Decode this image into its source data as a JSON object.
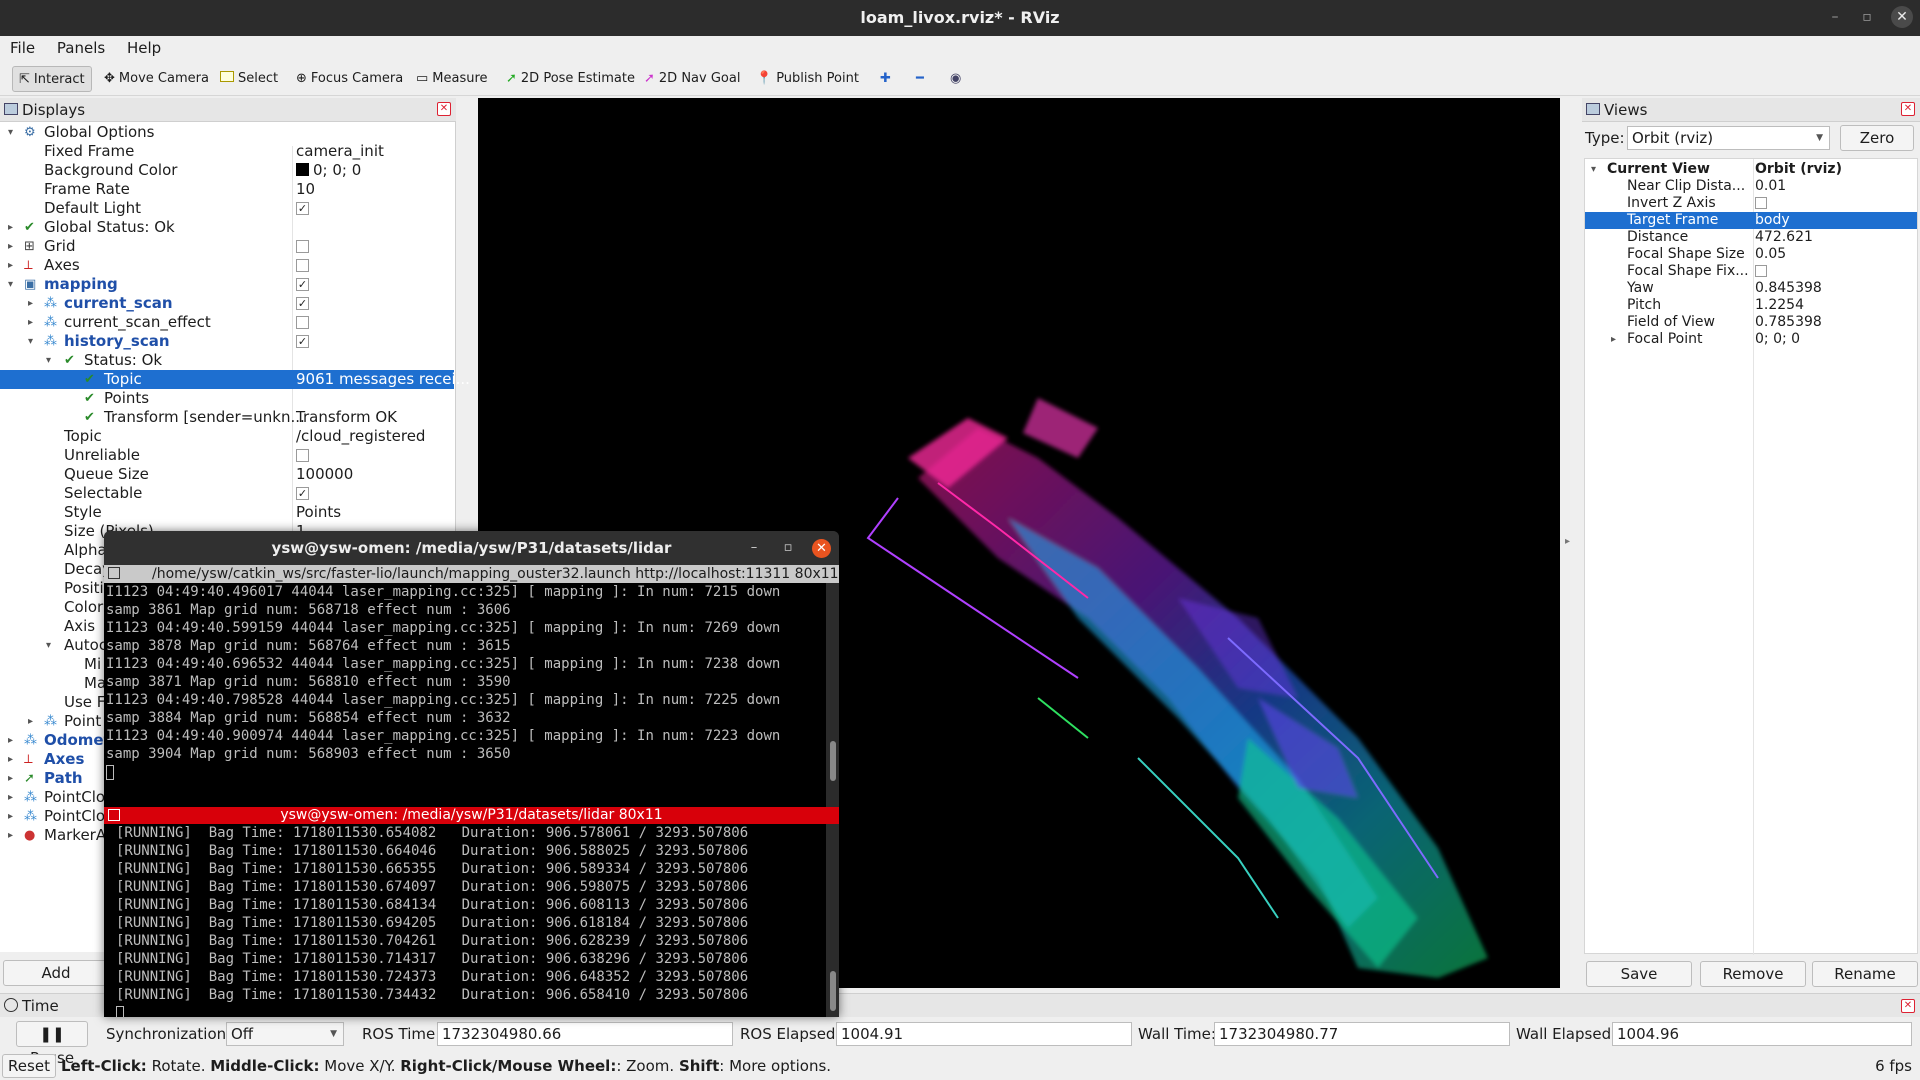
{
  "window": {
    "title": "loam_livox.rviz* - RViz"
  },
  "menu": [
    "File",
    "Panels",
    "Help"
  ],
  "toolbar": {
    "interact": "Interact",
    "move_camera": "Move Camera",
    "select": "Select",
    "focus_camera": "Focus Camera",
    "measure": "Measure",
    "pose_estimate": "2D Pose Estimate",
    "nav_goal": "2D Nav Goal",
    "publish_point": "Publish Point"
  },
  "displays": {
    "title": "Displays",
    "add_label": "Add",
    "rows": [
      {
        "label": "Global Options",
        "value": ""
      },
      {
        "label": "Fixed Frame",
        "value": "camera_init"
      },
      {
        "label": "Background Color",
        "value": "0; 0; 0"
      },
      {
        "label": "Frame Rate",
        "value": "10"
      },
      {
        "label": "Default Light",
        "value": "✓"
      },
      {
        "label": "Global Status: Ok",
        "value": ""
      },
      {
        "label": "Grid",
        "value": ""
      },
      {
        "label": "Axes",
        "value": ""
      },
      {
        "label": "mapping",
        "value": "✓"
      },
      {
        "label": "current_scan",
        "value": "✓"
      },
      {
        "label": "current_scan_effect",
        "value": ""
      },
      {
        "label": "history_scan",
        "value": "✓"
      },
      {
        "label": "Status: Ok",
        "value": ""
      },
      {
        "label": "Topic",
        "value": "9061 messages recei..."
      },
      {
        "label": "Points",
        "value": ""
      },
      {
        "label": "Transform [sender=unkn...",
        "value": "Transform OK"
      },
      {
        "label": "Topic",
        "value": "/cloud_registered"
      },
      {
        "label": "Unreliable",
        "value": ""
      },
      {
        "label": "Queue Size",
        "value": "100000"
      },
      {
        "label": "Selectable",
        "value": "✓"
      },
      {
        "label": "Style",
        "value": "Points"
      },
      {
        "label": "Size (Pixels)",
        "value": "1"
      },
      {
        "label": "Alpha",
        "value": ""
      },
      {
        "label": "Decay",
        "value": ""
      },
      {
        "label": "Positi",
        "value": ""
      },
      {
        "label": "Color",
        "value": ""
      },
      {
        "label": "Axis",
        "value": ""
      },
      {
        "label": "Autoc",
        "value": ""
      },
      {
        "label": "Mi",
        "value": ""
      },
      {
        "label": "Ma",
        "value": ""
      },
      {
        "label": "Use Fi",
        "value": ""
      },
      {
        "label": "Point",
        "value": ""
      },
      {
        "label": "Odomet",
        "value": ""
      },
      {
        "label": "Axes",
        "value": ""
      },
      {
        "label": "Path",
        "value": ""
      },
      {
        "label": "PointClo",
        "value": ""
      },
      {
        "label": "PointClo",
        "value": ""
      },
      {
        "label": "MarkerA",
        "value": ""
      }
    ]
  },
  "views": {
    "title": "Views",
    "type_label": "Type:",
    "type_value": "Orbit (rviz)",
    "zero_label": "Zero",
    "rows": [
      {
        "label": "Current View",
        "value": "Orbit (rviz)"
      },
      {
        "label": "Near Clip Dista...",
        "value": "0.01"
      },
      {
        "label": "Invert Z Axis",
        "value": ""
      },
      {
        "label": "Target Frame",
        "value": "body"
      },
      {
        "label": "Distance",
        "value": "472.621"
      },
      {
        "label": "Focal Shape Size",
        "value": "0.05"
      },
      {
        "label": "Focal Shape Fix...",
        "value": ""
      },
      {
        "label": "Yaw",
        "value": "0.845398"
      },
      {
        "label": "Pitch",
        "value": "1.2254"
      },
      {
        "label": "Field of View",
        "value": "0.785398"
      },
      {
        "label": "Focal Point",
        "value": "0; 0; 0"
      }
    ],
    "save_label": "Save",
    "remove_label": "Remove",
    "rename_label": "Rename"
  },
  "terminal": {
    "title": "ysw@ysw-omen: /media/ysw/P31/datasets/lidar",
    "path_bar": "/home/ysw/catkin_ws/src/faster-lio/launch/mapping_ouster32.launch http://localhost:11311 80x11",
    "pane1_lines": [
      "I1123 04:49:40.496017 44044 laser_mapping.cc:325] [ mapping ]: In num: 7215 down",
      "samp 3861 Map grid num: 568718 effect num : 3606",
      "I1123 04:49:40.599159 44044 laser_mapping.cc:325] [ mapping ]: In num: 7269 down",
      "samp 3878 Map grid num: 568764 effect num : 3615",
      "I1123 04:49:40.696532 44044 laser_mapping.cc:325] [ mapping ]: In num: 7238 down",
      "samp 3871 Map grid num: 568810 effect num : 3590",
      "I1123 04:49:40.798528 44044 laser_mapping.cc:325] [ mapping ]: In num: 7225 down",
      "samp 3884 Map grid num: 568854 effect num : 3632",
      "I1123 04:49:40.900974 44044 laser_mapping.cc:325] [ mapping ]: In num: 7223 down",
      "samp 3904 Map grid num: 568903 effect num : 3650"
    ],
    "pane2_title": "ysw@ysw-omen: /media/ysw/P31/datasets/lidar 80x11",
    "pane2_lines": [
      "[RUNNING]  Bag Time: 1718011530.654082   Duration: 906.578061 / 3293.507806",
      "[RUNNING]  Bag Time: 1718011530.664046   Duration: 906.588025 / 3293.507806",
      "[RUNNING]  Bag Time: 1718011530.665355   Duration: 906.589334 / 3293.507806",
      "[RUNNING]  Bag Time: 1718011530.674097   Duration: 906.598075 / 3293.507806",
      "[RUNNING]  Bag Time: 1718011530.684134   Duration: 906.608113 / 3293.507806",
      "[RUNNING]  Bag Time: 1718011530.694205   Duration: 906.618184 / 3293.507806",
      "[RUNNING]  Bag Time: 1718011530.704261   Duration: 906.628239 / 3293.507806",
      "[RUNNING]  Bag Time: 1718011530.714317   Duration: 906.638296 / 3293.507806",
      "[RUNNING]  Bag Time: 1718011530.724373   Duration: 906.648352 / 3293.507806",
      "[RUNNING]  Bag Time: 1718011530.734432   Duration: 906.658410 / 3293.507806"
    ]
  },
  "time": {
    "title": "Time",
    "pause_label": "Pause",
    "sync_label": "Synchronization:",
    "sync_value": "Off",
    "ros_time_label": "ROS Time:",
    "ros_time": "1732304980.66",
    "ros_elapsed_label": "ROS Elapsed:",
    "ros_elapsed": "1004.91",
    "wall_time_label": "Wall Time:",
    "wall_time": "1732304980.77",
    "wall_elapsed_label": "Wall Elapsed:",
    "wall_elapsed": "1004.96"
  },
  "status": {
    "reset_label": "Reset",
    "b1": "Left-Click:",
    "t1": " Rotate. ",
    "b2": "Middle-Click:",
    "t2": " Move X/Y. ",
    "b3": "Right-Click/Mouse Wheel:",
    "t3": ": Zoom. ",
    "b4": "Shift",
    "t4": ": More options.",
    "fps": "6 fps"
  },
  "colors": {
    "selection": "#1e6fd0",
    "terminal_accent": "#d8000a",
    "close_orange": "#e95420"
  }
}
